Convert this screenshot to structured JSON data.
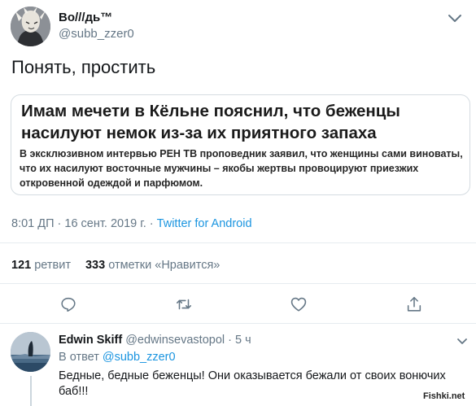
{
  "tweet": {
    "author_name": "Bo///дь™",
    "author_handle": "@subb_zzer0",
    "text": "Понять, простить",
    "quote": {
      "headline": "Имам мечети в Кёльне пояснил, что беженцы насилуют немок из-за их приятного запаха",
      "lead": "В эксклюзивном интервью РЕН ТВ проповедник заявил, что женщины сами виноваты, что их насилуют восточные мужчины – якобы жертвы провоцируют приезжих откровенной одеждой и парфюмом."
    },
    "time": "8:01 ДП · 16 сент. 2019 г. · ",
    "source": "Twitter for Android",
    "retweet_count": "121",
    "retweet_label": "ретвит",
    "like_count": "333",
    "like_label": "отметки «Нравится»"
  },
  "actions": [
    {
      "icon": "reply-icon"
    },
    {
      "icon": "retweet-icon"
    },
    {
      "icon": "like-icon"
    },
    {
      "icon": "share-icon"
    }
  ],
  "reply": {
    "author_name": "Edwin Skiff",
    "author_handle": "@edwinsevastopol",
    "time": "· 5 ч",
    "in_reply_prefix": "В ответ ",
    "in_reply_handle": "@subb_zzer0",
    "text": "Бедные, бедные беженцы! Они оказывается бежали от своих вонючих баб!!!"
  },
  "watermark": "Fishki.net",
  "colors": {
    "link": "#1b95e0",
    "secondary_text": "#657786",
    "divider": "#e6ecf0"
  }
}
